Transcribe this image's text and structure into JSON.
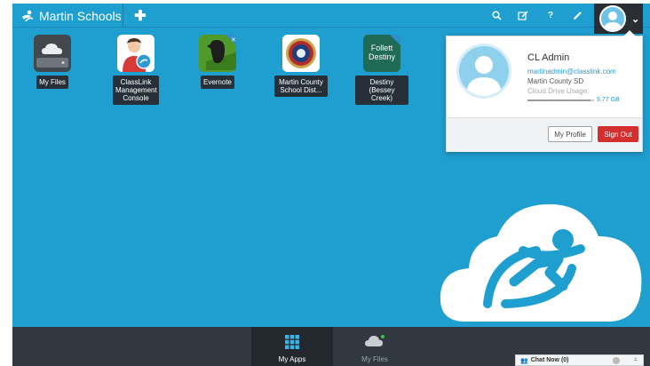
{
  "header": {
    "brand": "Martin Schools"
  },
  "apps": [
    {
      "label": "My Files"
    },
    {
      "label": "ClassLink Management Console"
    },
    {
      "label": "Evernote"
    },
    {
      "label": "Martin County School Dist..."
    },
    {
      "label": "Destiny (Bessey Creek)",
      "icon_text": "Follett Destiny"
    }
  ],
  "profile": {
    "name": "CL Admin",
    "email": "martinadmin@classlink.com",
    "org": "Martin County SD",
    "usage_label": "Cloud Drive Usage:",
    "usage_value": "9.77 GB",
    "usage_fraction": 0.95,
    "my_profile_label": "My Profile",
    "sign_out_label": "Sign Out"
  },
  "bottom_tabs": [
    {
      "label": "My Apps"
    },
    {
      "label": "My Files"
    }
  ],
  "chat": {
    "label": "Chat Now (0)"
  },
  "colors": {
    "background": "#1f9fcf",
    "bottom_bar": "#313840",
    "sign_out": "#d32f2f",
    "link": "#2b9bd4"
  }
}
